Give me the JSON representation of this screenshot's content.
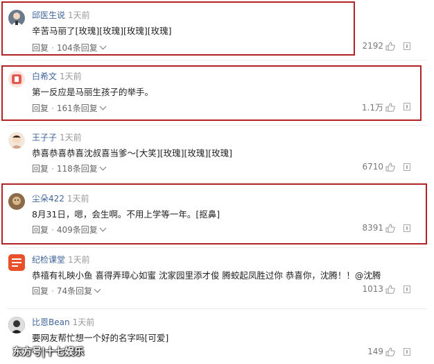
{
  "comments": [
    {
      "user": "邱医生说",
      "time": "1天前",
      "text": "辛苦马丽了[玫瑰][玫瑰][玫瑰][玫瑰]",
      "reply_label": "回复",
      "reply_count": "104条回复",
      "likes": "2192",
      "highlighted": true,
      "avatar_color": "#6b7b8c"
    },
    {
      "user": "白希文",
      "time": "1天前",
      "text": "第一反应是马丽生孩子的举手。",
      "reply_label": "回复",
      "reply_count": "161条回复",
      "likes": "1.1万",
      "highlighted": true,
      "avatar_color": "#d9534f"
    },
    {
      "user": "王子子",
      "time": "1天前",
      "text": "恭喜恭喜恭喜沈叔喜当爹～[大笑][玫瑰][玫瑰][玫瑰]",
      "reply_label": "回复",
      "reply_count": "118条回复",
      "likes": "6710",
      "highlighted": false,
      "avatar_color": "#e8c9b0"
    },
    {
      "user": "尘朵422",
      "time": "1天前",
      "text": "8月31日，嗯，会生啊。不用上学等一年。[抠鼻]",
      "reply_label": "回复",
      "reply_count": "409条回复",
      "likes": "8391",
      "highlighted": true,
      "avatar_color": "#a08060"
    },
    {
      "user": "纪检课堂",
      "time": "1天前",
      "text": "恭禧有礼映小鱼 喜得弄璋心如蜜 沈家园里添才俊 腾蛟起凤胜过你 恭喜你，沈腾！！@沈腾",
      "reply_label": "回复",
      "reply_count": "74条回复",
      "likes": "1013",
      "highlighted": false,
      "avatar_color": "#e8502a"
    },
    {
      "user": "比恩Bean",
      "time": "1天前",
      "text": "要网友帮忙想一个好的名字吗[可爱]",
      "reply_label": "回复",
      "reply_count": "",
      "likes": "149",
      "highlighted": false,
      "avatar_color": "#555555"
    }
  ],
  "watermark": "东方号|十七娱乐",
  "colors": {
    "highlight_border": "#b22222",
    "username": "#406599"
  }
}
